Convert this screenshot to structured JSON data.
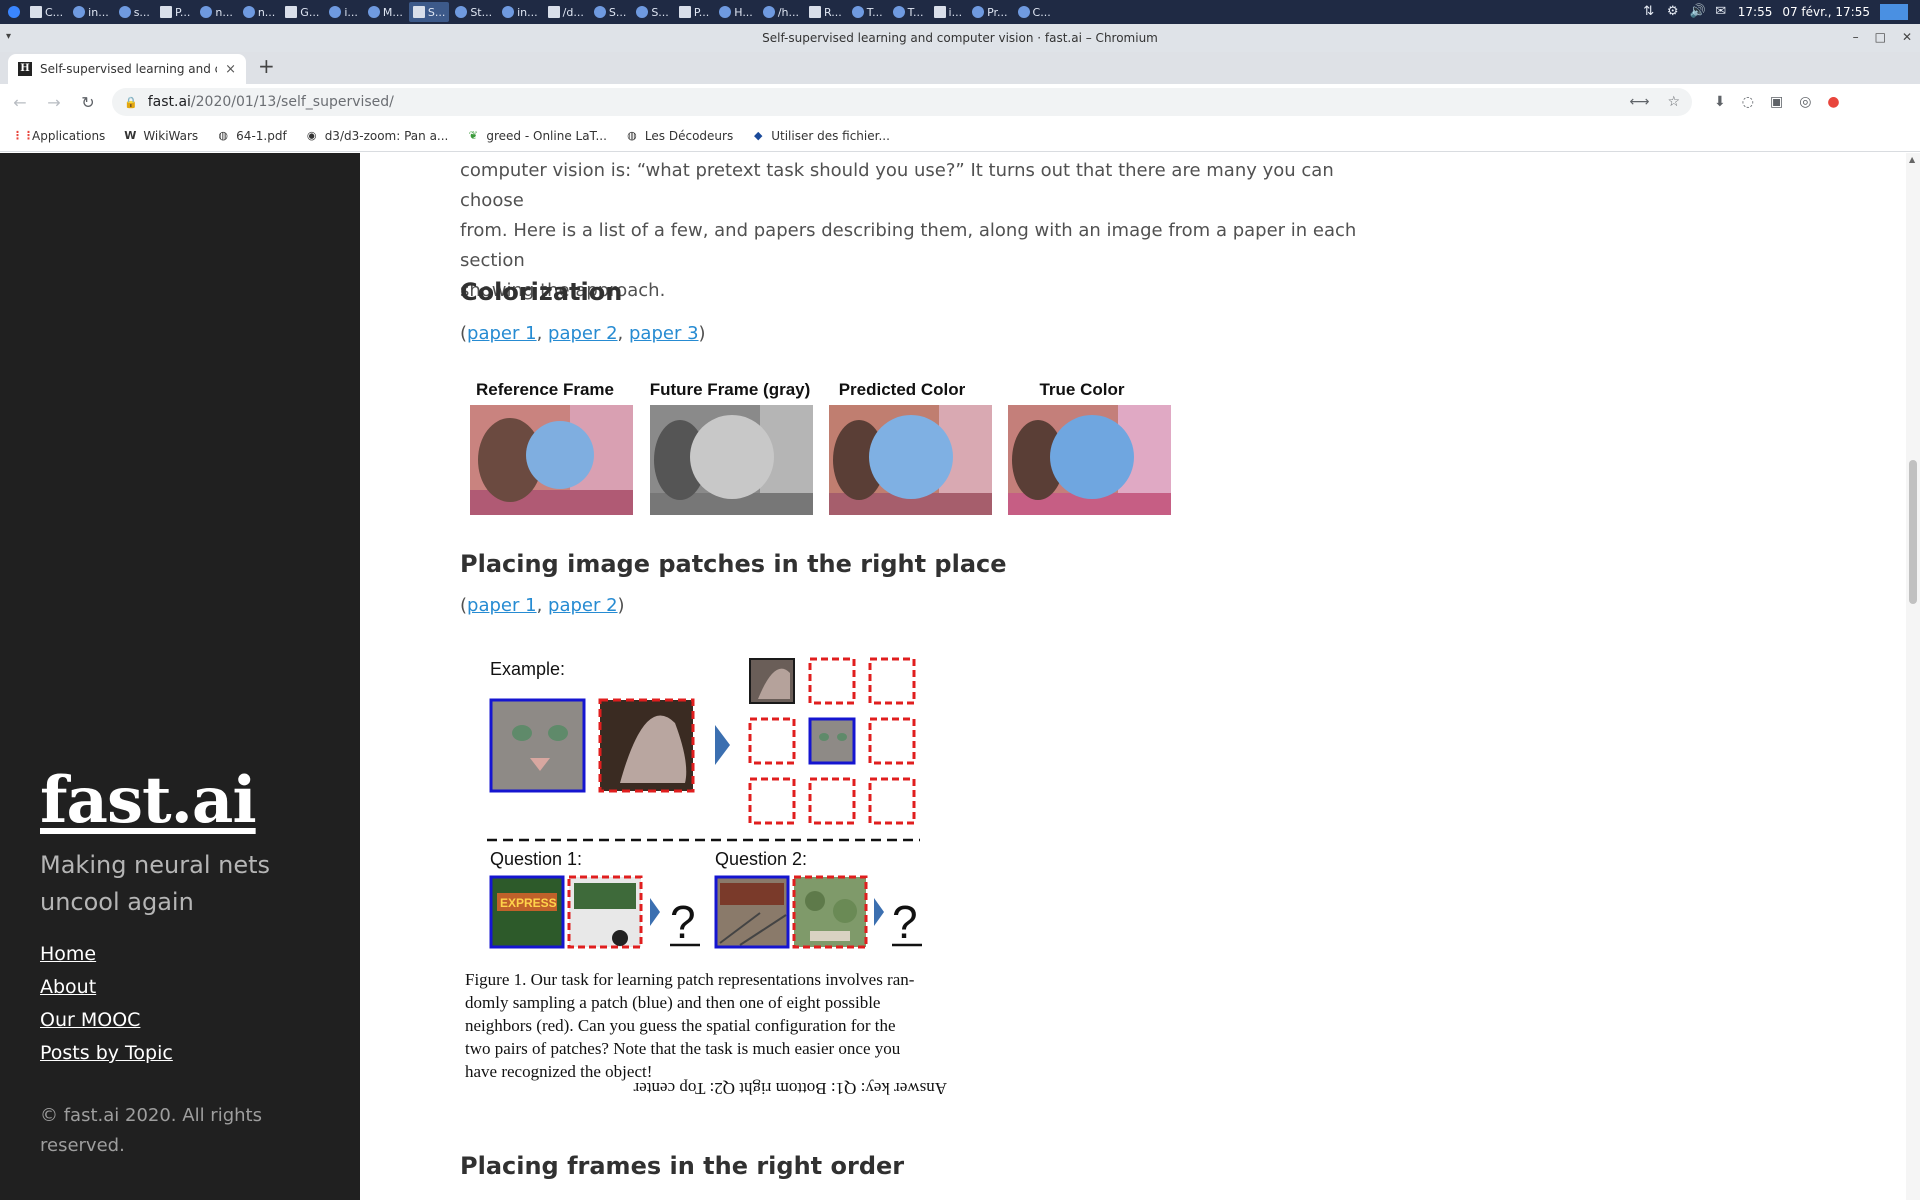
{
  "taskbar": {
    "items": [
      "C...",
      "in...",
      "s...",
      "P...",
      "n...",
      "n...",
      "G...",
      "i...",
      "M...",
      "S...",
      "St...",
      "in...",
      "/d...",
      "S...",
      "S...",
      "P...",
      "H...",
      "/h...",
      "R...",
      "T...",
      "T...",
      "i...",
      "Pr...",
      "C..."
    ],
    "active_index": 9,
    "clock": "17:55",
    "date": "07 févr., 17:55"
  },
  "window": {
    "title": "Self-supervised learning and computer vision · fast.ai – Chromium"
  },
  "tab": {
    "favicon": "H",
    "title": "Self-supervised learning and co",
    "close": "×",
    "new_tab": "+"
  },
  "omnibox": {
    "host": "fast.ai",
    "path": "/2020/01/13/self_supervised/"
  },
  "bookmarks": [
    {
      "label": "Applications",
      "icon": "apps-grid-icon"
    },
    {
      "label": "WikiWars",
      "icon": "wikipedia-icon"
    },
    {
      "label": "64-1.pdf",
      "icon": "globe-icon"
    },
    {
      "label": "d3/d3-zoom: Pan a...",
      "icon": "github-icon"
    },
    {
      "label": "greed - Online LaT...",
      "icon": "overleaf-icon"
    },
    {
      "label": "Les Décodeurs",
      "icon": "globe-icon"
    },
    {
      "label": "Utiliser des fichier...",
      "icon": "shield-icon"
    }
  ],
  "sidebar": {
    "brand": "fast.ai",
    "tagline": "Making neural nets uncool again",
    "nav": [
      "Home",
      "About",
      "Our MOOC",
      "Posts by Topic"
    ],
    "copyright": "© fast.ai 2020. All rights reserved."
  },
  "article": {
    "intro_lines": [
      "computer vision is: “what pretext task should you use?” It turns out that there are many you can choose",
      "from. Here is a list of a few, and papers describing them, along with an image from a paper in each section",
      "showing the approach."
    ],
    "sections": [
      {
        "heading": "Colorization",
        "links": [
          "paper 1",
          "paper 2",
          "paper 3"
        ]
      },
      {
        "heading": "Placing image patches in the right place",
        "links": [
          "paper 1",
          "paper 2"
        ]
      },
      {
        "heading": "Placing frames in the right order"
      }
    ],
    "colorization_figure": {
      "labels": [
        "Reference Frame",
        "Future Frame (gray)",
        "Predicted Color",
        "True Color"
      ]
    },
    "patch_figure": {
      "example_label": "Example:",
      "question1": "Question 1:",
      "question2": "Question 2:",
      "question_mark": "?",
      "express_text": "EXPRESS",
      "caption_lines": [
        "Figure 1. Our task for learning patch representations involves ran-",
        "domly sampling a patch (blue) and then one of eight possible",
        "neighbors (red).  Can you guess the spatial configuration for the",
        "two pairs of patches? Note that the task is much easier once you",
        "have recognized the object!"
      ],
      "answer_key": "Answer key: Q1: Bottom right Q2: Top center"
    }
  },
  "colors": {
    "sidebar_bg": "#202020",
    "link": "#268bd2",
    "heading": "#313131",
    "body_text": "#515151"
  }
}
